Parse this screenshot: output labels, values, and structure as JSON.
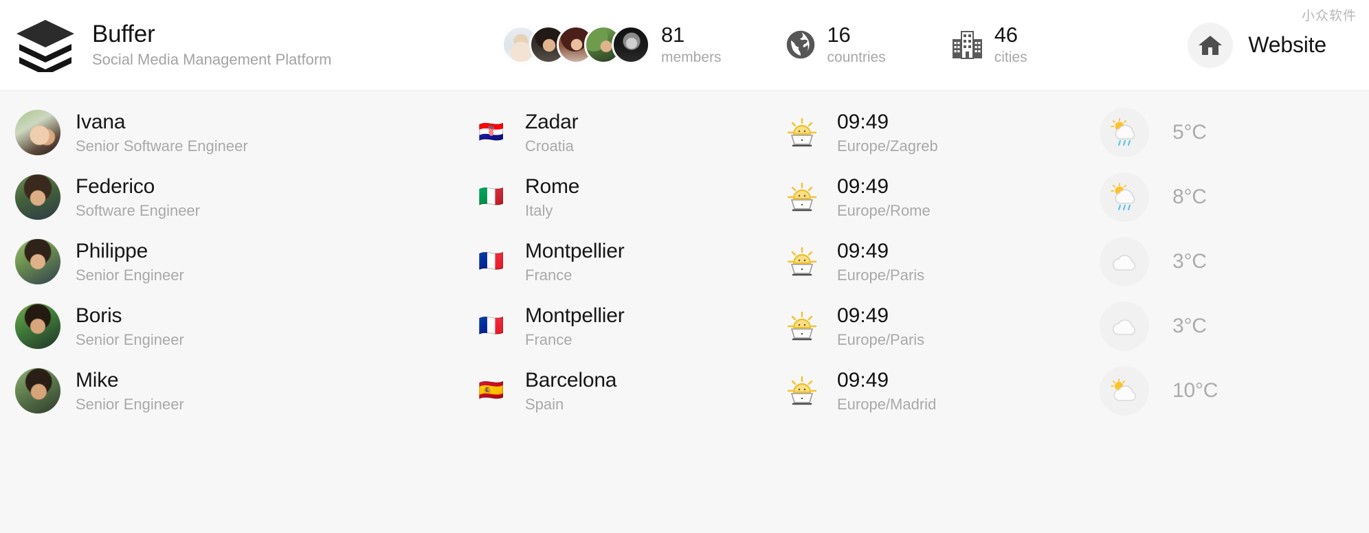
{
  "header": {
    "brand_name": "Buffer",
    "brand_tagline": "Social Media Management Platform",
    "logo_icon": "stacked-layers-icon",
    "watermark": "小众软件",
    "stats": {
      "members": {
        "value": "81",
        "label": "members",
        "icon": "avatar-stack"
      },
      "countries": {
        "value": "16",
        "label": "countries",
        "icon": "globe-icon"
      },
      "cities": {
        "value": "46",
        "label": "cities",
        "icon": "buildings-icon"
      }
    },
    "website": {
      "label": "Website",
      "icon": "home-icon"
    }
  },
  "members": [
    {
      "name": "Ivana",
      "role": "Senior Software Engineer",
      "avatar": "pv-ivana",
      "flag": "🇭🇷",
      "flag_name": "croatia-flag",
      "city": "Zadar",
      "country": "Croatia",
      "time": "09:49",
      "timezone": "Europe/Zagreb",
      "time_icon": "sunrise-icon",
      "weather_icon": "sun-behind-rain-cloud-icon",
      "temperature": "5°C"
    },
    {
      "name": "Federico",
      "role": "Software Engineer",
      "avatar": "pv-federico",
      "flag": "🇮🇹",
      "flag_name": "italy-flag",
      "city": "Rome",
      "country": "Italy",
      "time": "09:49",
      "timezone": "Europe/Rome",
      "time_icon": "sunrise-icon",
      "weather_icon": "sun-behind-rain-cloud-icon",
      "temperature": "8°C"
    },
    {
      "name": "Philippe",
      "role": "Senior Engineer",
      "avatar": "pv-philippe",
      "flag": "🇫🇷",
      "flag_name": "france-flag",
      "city": "Montpellier",
      "country": "France",
      "time": "09:49",
      "timezone": "Europe/Paris",
      "time_icon": "sunrise-icon",
      "weather_icon": "cloud-icon",
      "temperature": "3°C"
    },
    {
      "name": "Boris",
      "role": "Senior Engineer",
      "avatar": "pv-boris",
      "flag": "🇫🇷",
      "flag_name": "france-flag",
      "city": "Montpellier",
      "country": "France",
      "time": "09:49",
      "timezone": "Europe/Paris",
      "time_icon": "sunrise-icon",
      "weather_icon": "cloud-icon",
      "temperature": "3°C"
    },
    {
      "name": "Mike",
      "role": "Senior Engineer",
      "avatar": "pv-mike",
      "flag": "🇪🇸",
      "flag_name": "spain-flag",
      "city": "Barcelona",
      "country": "Spain",
      "time": "09:49",
      "timezone": "Europe/Madrid",
      "time_icon": "sunrise-icon",
      "weather_icon": "sun-behind-cloud-icon",
      "temperature": "10°C"
    }
  ],
  "colors": {
    "page_background": "#f7f7f7",
    "header_background": "#ffffff",
    "primary_text": "#161616",
    "muted_text": "#a9a9a9",
    "chip_background": "#f1f1f1"
  }
}
